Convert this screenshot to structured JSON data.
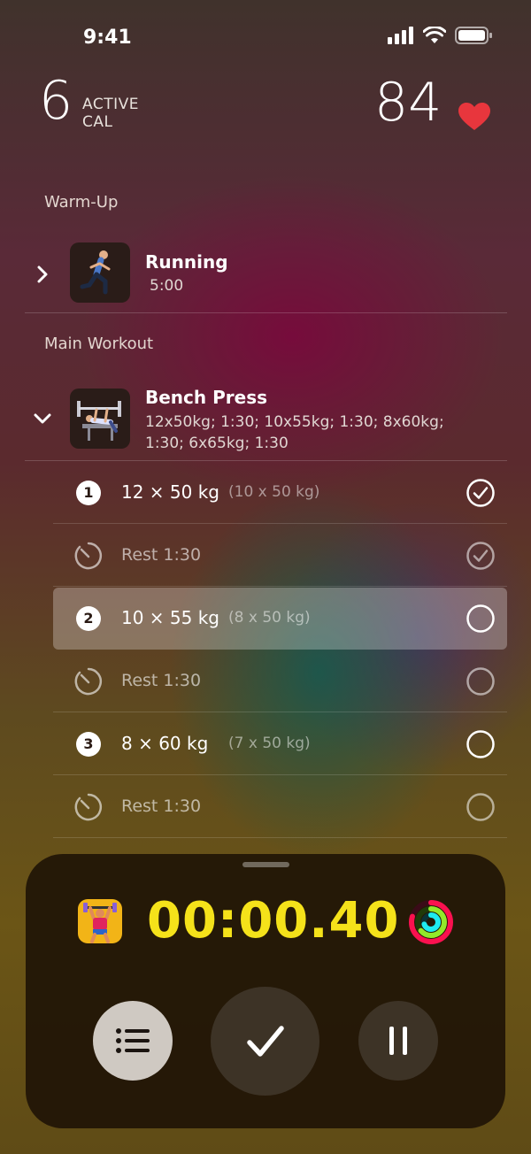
{
  "status_bar": {
    "time": "9:41"
  },
  "stats": {
    "active_cal_value": "6",
    "active_cal_label_line1": "ACTIVE",
    "active_cal_label_line2": "CAL",
    "heart_rate": "84"
  },
  "sections": {
    "warmup_title": "Warm-Up",
    "main_title": "Main Workout"
  },
  "warmup": {
    "name": "Running",
    "detail": "5:00"
  },
  "main_exercise": {
    "name": "Bench Press",
    "detail_line1": "12x50kg; 1:30; 10x55kg; 1:30; 8x60kg;",
    "detail_line2": "1:30; 6x65kg; 1:30"
  },
  "sets": [
    {
      "number": "1",
      "label": "12 × 50 kg",
      "previous": "(10 x 50 kg)",
      "status": "done"
    },
    {
      "rest": "Rest 1:30",
      "status": "done"
    },
    {
      "number": "2",
      "label": "10 × 55 kg",
      "previous": "(8 x 50 kg)",
      "status": "current"
    },
    {
      "rest": "Rest 1:30",
      "status": "pending"
    },
    {
      "number": "3",
      "label": "8 × 60 kg",
      "previous": "(7 x 50 kg)",
      "status": "pending"
    },
    {
      "rest": "Rest 1:30",
      "status": "pending"
    }
  ],
  "timer": {
    "elapsed": "00:00.40"
  },
  "colors": {
    "timer": "#f5e21a",
    "heart": "#e8363d",
    "ring_move": "#fa114f",
    "ring_exercise": "#92e82a",
    "ring_stand": "#1eeaef"
  },
  "icons": {
    "list": "list-icon",
    "done": "checkmark-icon",
    "pause": "pause-icon"
  }
}
